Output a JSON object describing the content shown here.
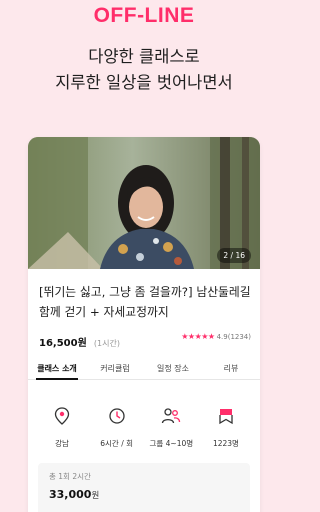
{
  "brand": "OFF-LINE",
  "headline": {
    "line1": "다양한 클래스로",
    "line2": "지루한 일상을 벗어나면서"
  },
  "card": {
    "image_counter": "2 / 16",
    "title": "[뛰기는 싫고, 그냥 좀 걸을까?] 남산둘레길 함께 걷기 + 자세교정까지",
    "price": "16,500원",
    "duration": "(1시간)",
    "stars": "★★★★★",
    "rating": "4.9(1234)",
    "tabs": [
      "클래스 소개",
      "커리큘럼",
      "일정 장소",
      "리뷰"
    ],
    "features": [
      {
        "icon": "location-pin-icon",
        "label": "강남"
      },
      {
        "icon": "clock-icon",
        "label": "6시간 / 회"
      },
      {
        "icon": "group-icon",
        "label": "그룹 4~10명"
      },
      {
        "icon": "bookmark-icon",
        "label": "1223명"
      }
    ],
    "total_label": "총 1회 2시간",
    "total_amount": "33,000",
    "total_currency": "원"
  },
  "colors": {
    "brand": "#ff2e6a",
    "background": "#fde8ec"
  }
}
